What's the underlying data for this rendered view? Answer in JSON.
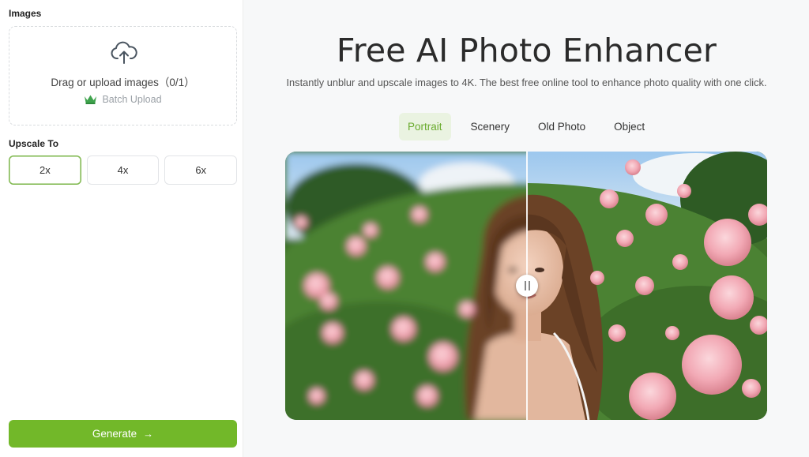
{
  "sidebar": {
    "images_label": "Images",
    "upload": {
      "icon": "cloud-upload-icon",
      "text": "Drag or upload images（0/1）",
      "batch_label": "Batch Upload",
      "batch_icon": "crown-icon"
    },
    "upscale_label": "Upscale To",
    "scale_options": [
      "2x",
      "4x",
      "6x"
    ],
    "selected_scale": "2x",
    "generate_label": "Generate",
    "generate_icon": "arrow-right-icon"
  },
  "main": {
    "title": "Free AI Photo Enhancer",
    "subtitle": "Instantly unblur and upscale images to 4K. The best free online tool to enhance photo quality with one click.",
    "tabs": [
      "Portrait",
      "Scenery",
      "Old Photo",
      "Object"
    ],
    "active_tab": "Portrait",
    "comparison": {
      "left_state": "blurred original",
      "right_state": "enhanced",
      "handle_icon": "compare-slider-handle-icon"
    }
  },
  "colors": {
    "accent": "#72b829",
    "accent_text": "#6aab2e",
    "tab_active_bg": "#eaf3e1"
  }
}
